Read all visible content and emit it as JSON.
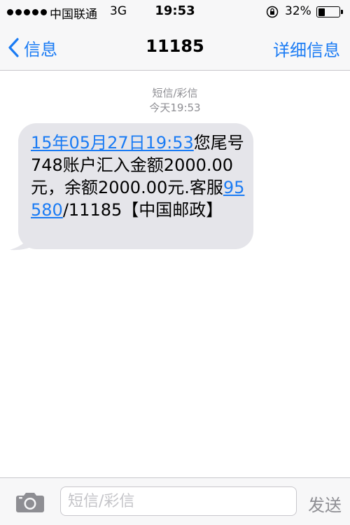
{
  "status_bar": {
    "carrier": "中国联通",
    "network": "3G",
    "time": "19:53",
    "battery_percent": "32%",
    "battery_level": 0.32,
    "icons": [
      "signal-dots-icon",
      "orientation-lock-icon",
      "battery-icon"
    ]
  },
  "nav": {
    "back_label": "信息",
    "title": "11185",
    "details_label": "详细信息"
  },
  "conversation": {
    "message_type": "短信/彩信",
    "timestamp": "今天19:53",
    "message": {
      "date_link": "15年05月27日19:53",
      "text_1": "您尾号748账户汇入金额2000.00元，余额2000.00元.客服",
      "phone_link": "95580",
      "text_2": "/11185【中国邮政】"
    }
  },
  "composer": {
    "placeholder": "短信/彩信",
    "value": "",
    "send_label": "发送"
  },
  "colors": {
    "accent": "#1a7bf4",
    "bubble": "#e5e5ea",
    "bar_bg": "#f7f7f8",
    "muted_text": "#8e8e93"
  }
}
